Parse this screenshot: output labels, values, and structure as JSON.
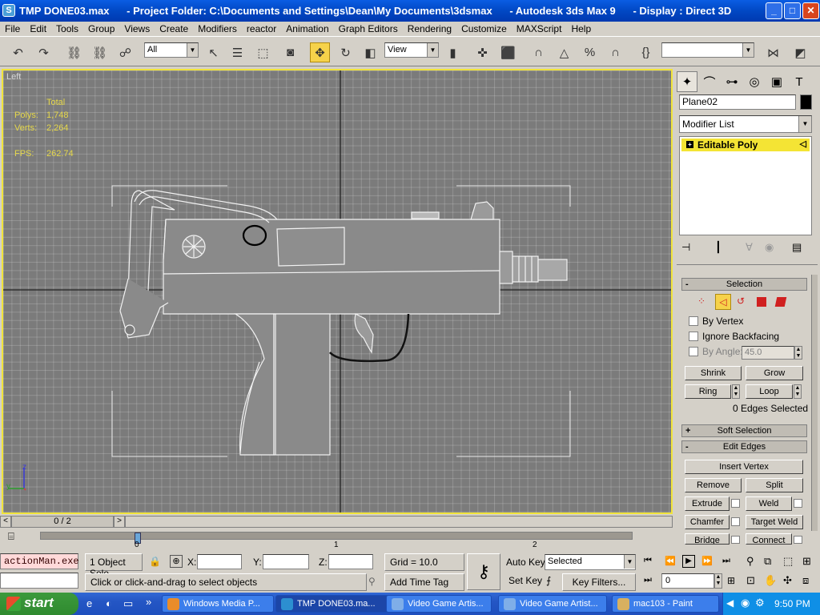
{
  "titlebar": {
    "title": "TMP DONE03.max      - Project Folder: C:\\Documents and Settings\\Dean\\My Documents\\3dsmax      - Autodesk 3ds Max 9      - Display : Direct 3D",
    "app_icon": "3ds-max-icon",
    "minimize": "_",
    "maximize": "□",
    "close": "✕"
  },
  "menubar": [
    "File",
    "Edit",
    "Tools",
    "Group",
    "Views",
    "Create",
    "Modifiers",
    "reactor",
    "Animation",
    "Graph Editors",
    "Rendering",
    "Customize",
    "MAXScript",
    "Help"
  ],
  "toolbar": {
    "selection_filter": "All",
    "reference_coord": "View",
    "named_selection": ""
  },
  "viewport": {
    "label": "Left",
    "stats_header": "Total",
    "polys_label": "Polys:",
    "polys_value": "1,748",
    "verts_label": "Verts:",
    "verts_value": "2,264",
    "fps_label": "FPS:",
    "fps_value": "262.74",
    "axis_z": "z",
    "axis_y": "y",
    "border_color": "#f1e43b"
  },
  "command_panel": {
    "object_name": "Plane02",
    "modifier_list": "Modifier List",
    "stack_item": "Editable Poly",
    "selection": {
      "header": "Selection",
      "by_vertex": "By Vertex",
      "ignore_backfacing": "Ignore Backfacing",
      "by_angle": "By Angle:",
      "angle_value": "45.0",
      "shrink": "Shrink",
      "grow": "Grow",
      "ring": "Ring",
      "loop": "Loop",
      "status": "0 Edges Selected"
    },
    "soft_selection": "Soft Selection",
    "edit_edges": {
      "header": "Edit Edges",
      "insert_vertex": "Insert Vertex",
      "remove": "Remove",
      "split": "Split",
      "extrude": "Extrude",
      "weld": "Weld",
      "chamfer": "Chamfer",
      "target_weld": "Target Weld",
      "bridge": "Bridge",
      "connect": "Connect"
    },
    "sign_minus": "-",
    "sign_plus": "+"
  },
  "timeline": {
    "frame": "0 / 2",
    "prev": "<",
    "next": ">",
    "ticks": [
      "0",
      "1",
      "2"
    ]
  },
  "status": {
    "maxscript_listener": "actionMan.exe",
    "selection": "1 Object Sele",
    "x_label": "X:",
    "y_label": "Y:",
    "z_label": "Z:",
    "grid": "Grid = 10.0",
    "auto_key": "Auto Key",
    "set_key": "Set Key",
    "key_mode": "Selected",
    "key_filters": "Key Filters...",
    "current_frame": "0",
    "prompt": "Click or click-and-drag to select objects",
    "add_time_tag": "Add Time Tag"
  },
  "taskbar": {
    "start": "start",
    "tasks": [
      "Windows Media P...",
      "TMP DONE03.ma...",
      "Video Game Artis...",
      "Video Game Artist...",
      "mac103 - Paint"
    ],
    "clock": "9:50 PM",
    "overflow": "»"
  }
}
